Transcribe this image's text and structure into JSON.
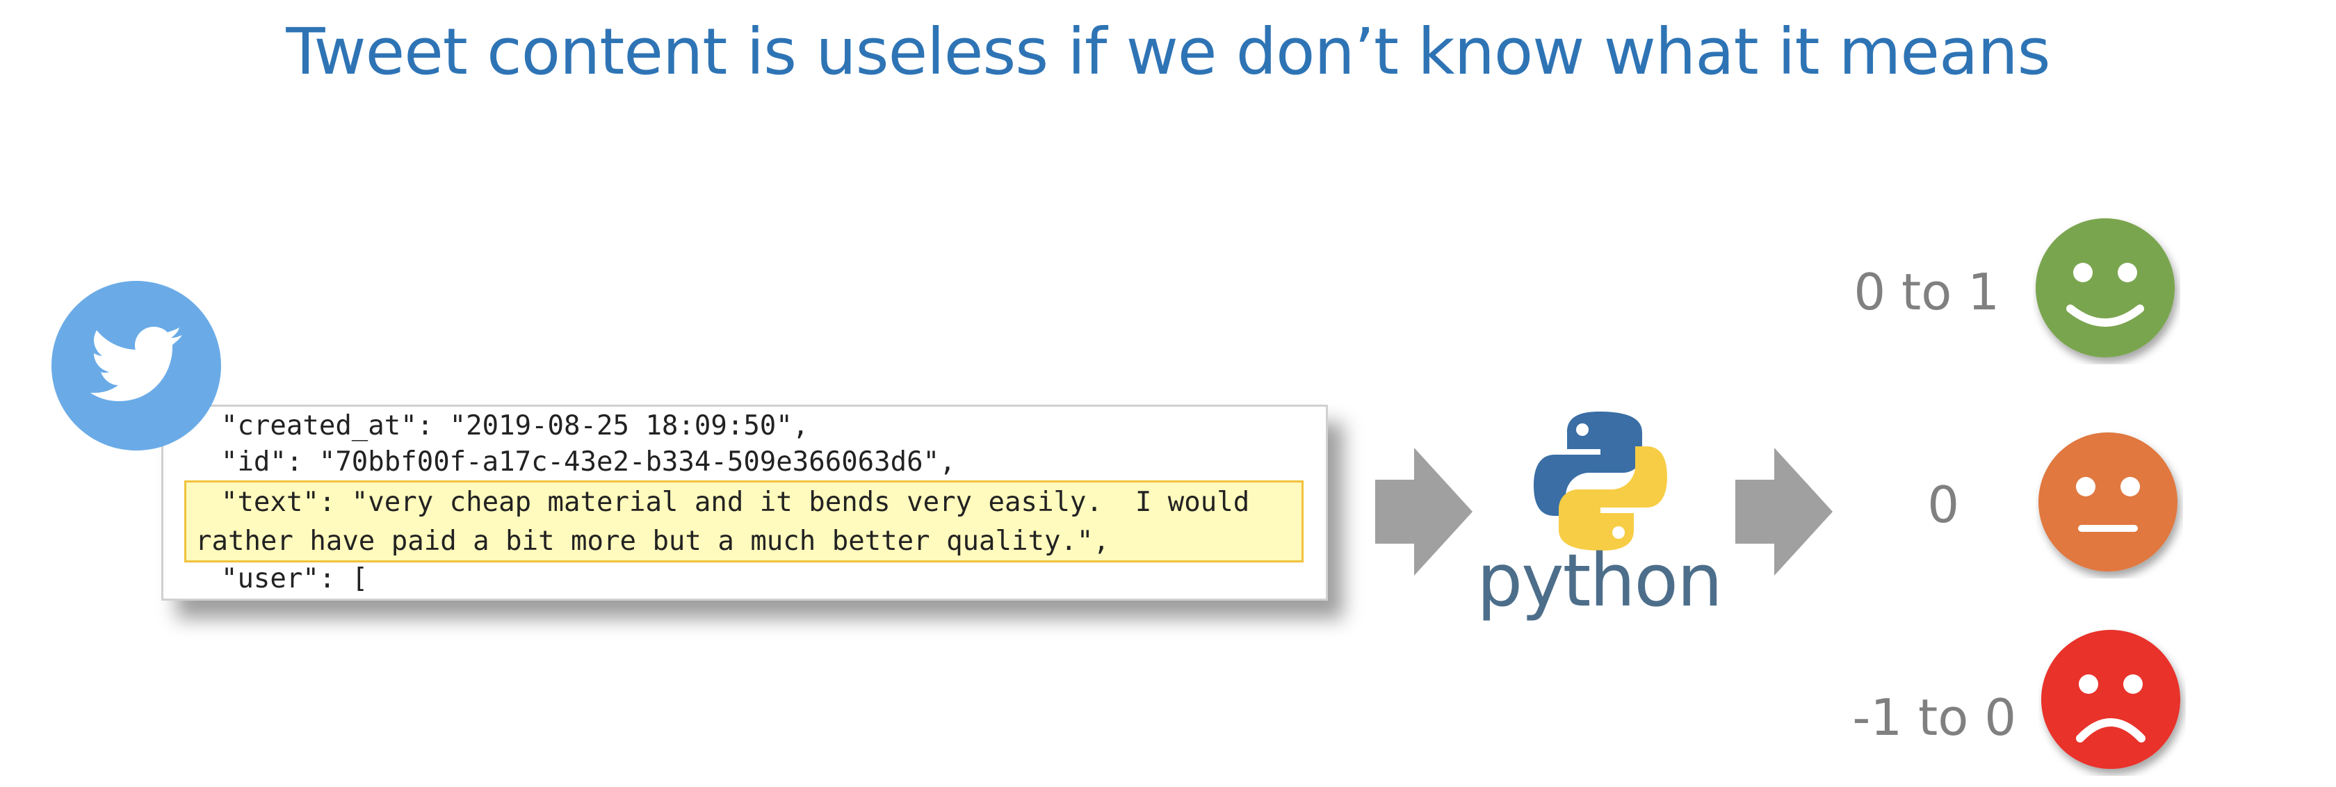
{
  "slide": {
    "title": "Tweet content is useless if we don’t know what it means"
  },
  "tweet": {
    "source_icon": "twitter-bird-icon",
    "lines": [
      "  \"created_at\": \"2019-08-25 18:09:50\",",
      "  \"id\": \"70bbf00f-a17c-43e2-b334-509e366063d6\",",
      "  \"text\": \"very cheap material and it bends very easily.  I would",
      "rather have paid a bit more but a much better quality.\",",
      "  \"user\": ["
    ],
    "highlight_color": "#fffabd",
    "highlight_border": "#f0c23c"
  },
  "processor": {
    "icon": "python-logo-icon",
    "label": "python"
  },
  "sentiments": [
    {
      "range": "0 to 1",
      "icon": "smiley-face-icon",
      "color": "#7aa550"
    },
    {
      "range": "0",
      "icon": "neutral-face-icon",
      "color": "#e0783f"
    },
    {
      "range": "-1 to 0",
      "icon": "sad-face-icon",
      "color": "#e8302a"
    }
  ],
  "colors": {
    "title": "#2e74b5",
    "arrow": "#a0a0a0",
    "twitter_blue": "#6aabe7",
    "python_blue": "#3a6ea5",
    "python_yellow": "#f7cd45"
  }
}
